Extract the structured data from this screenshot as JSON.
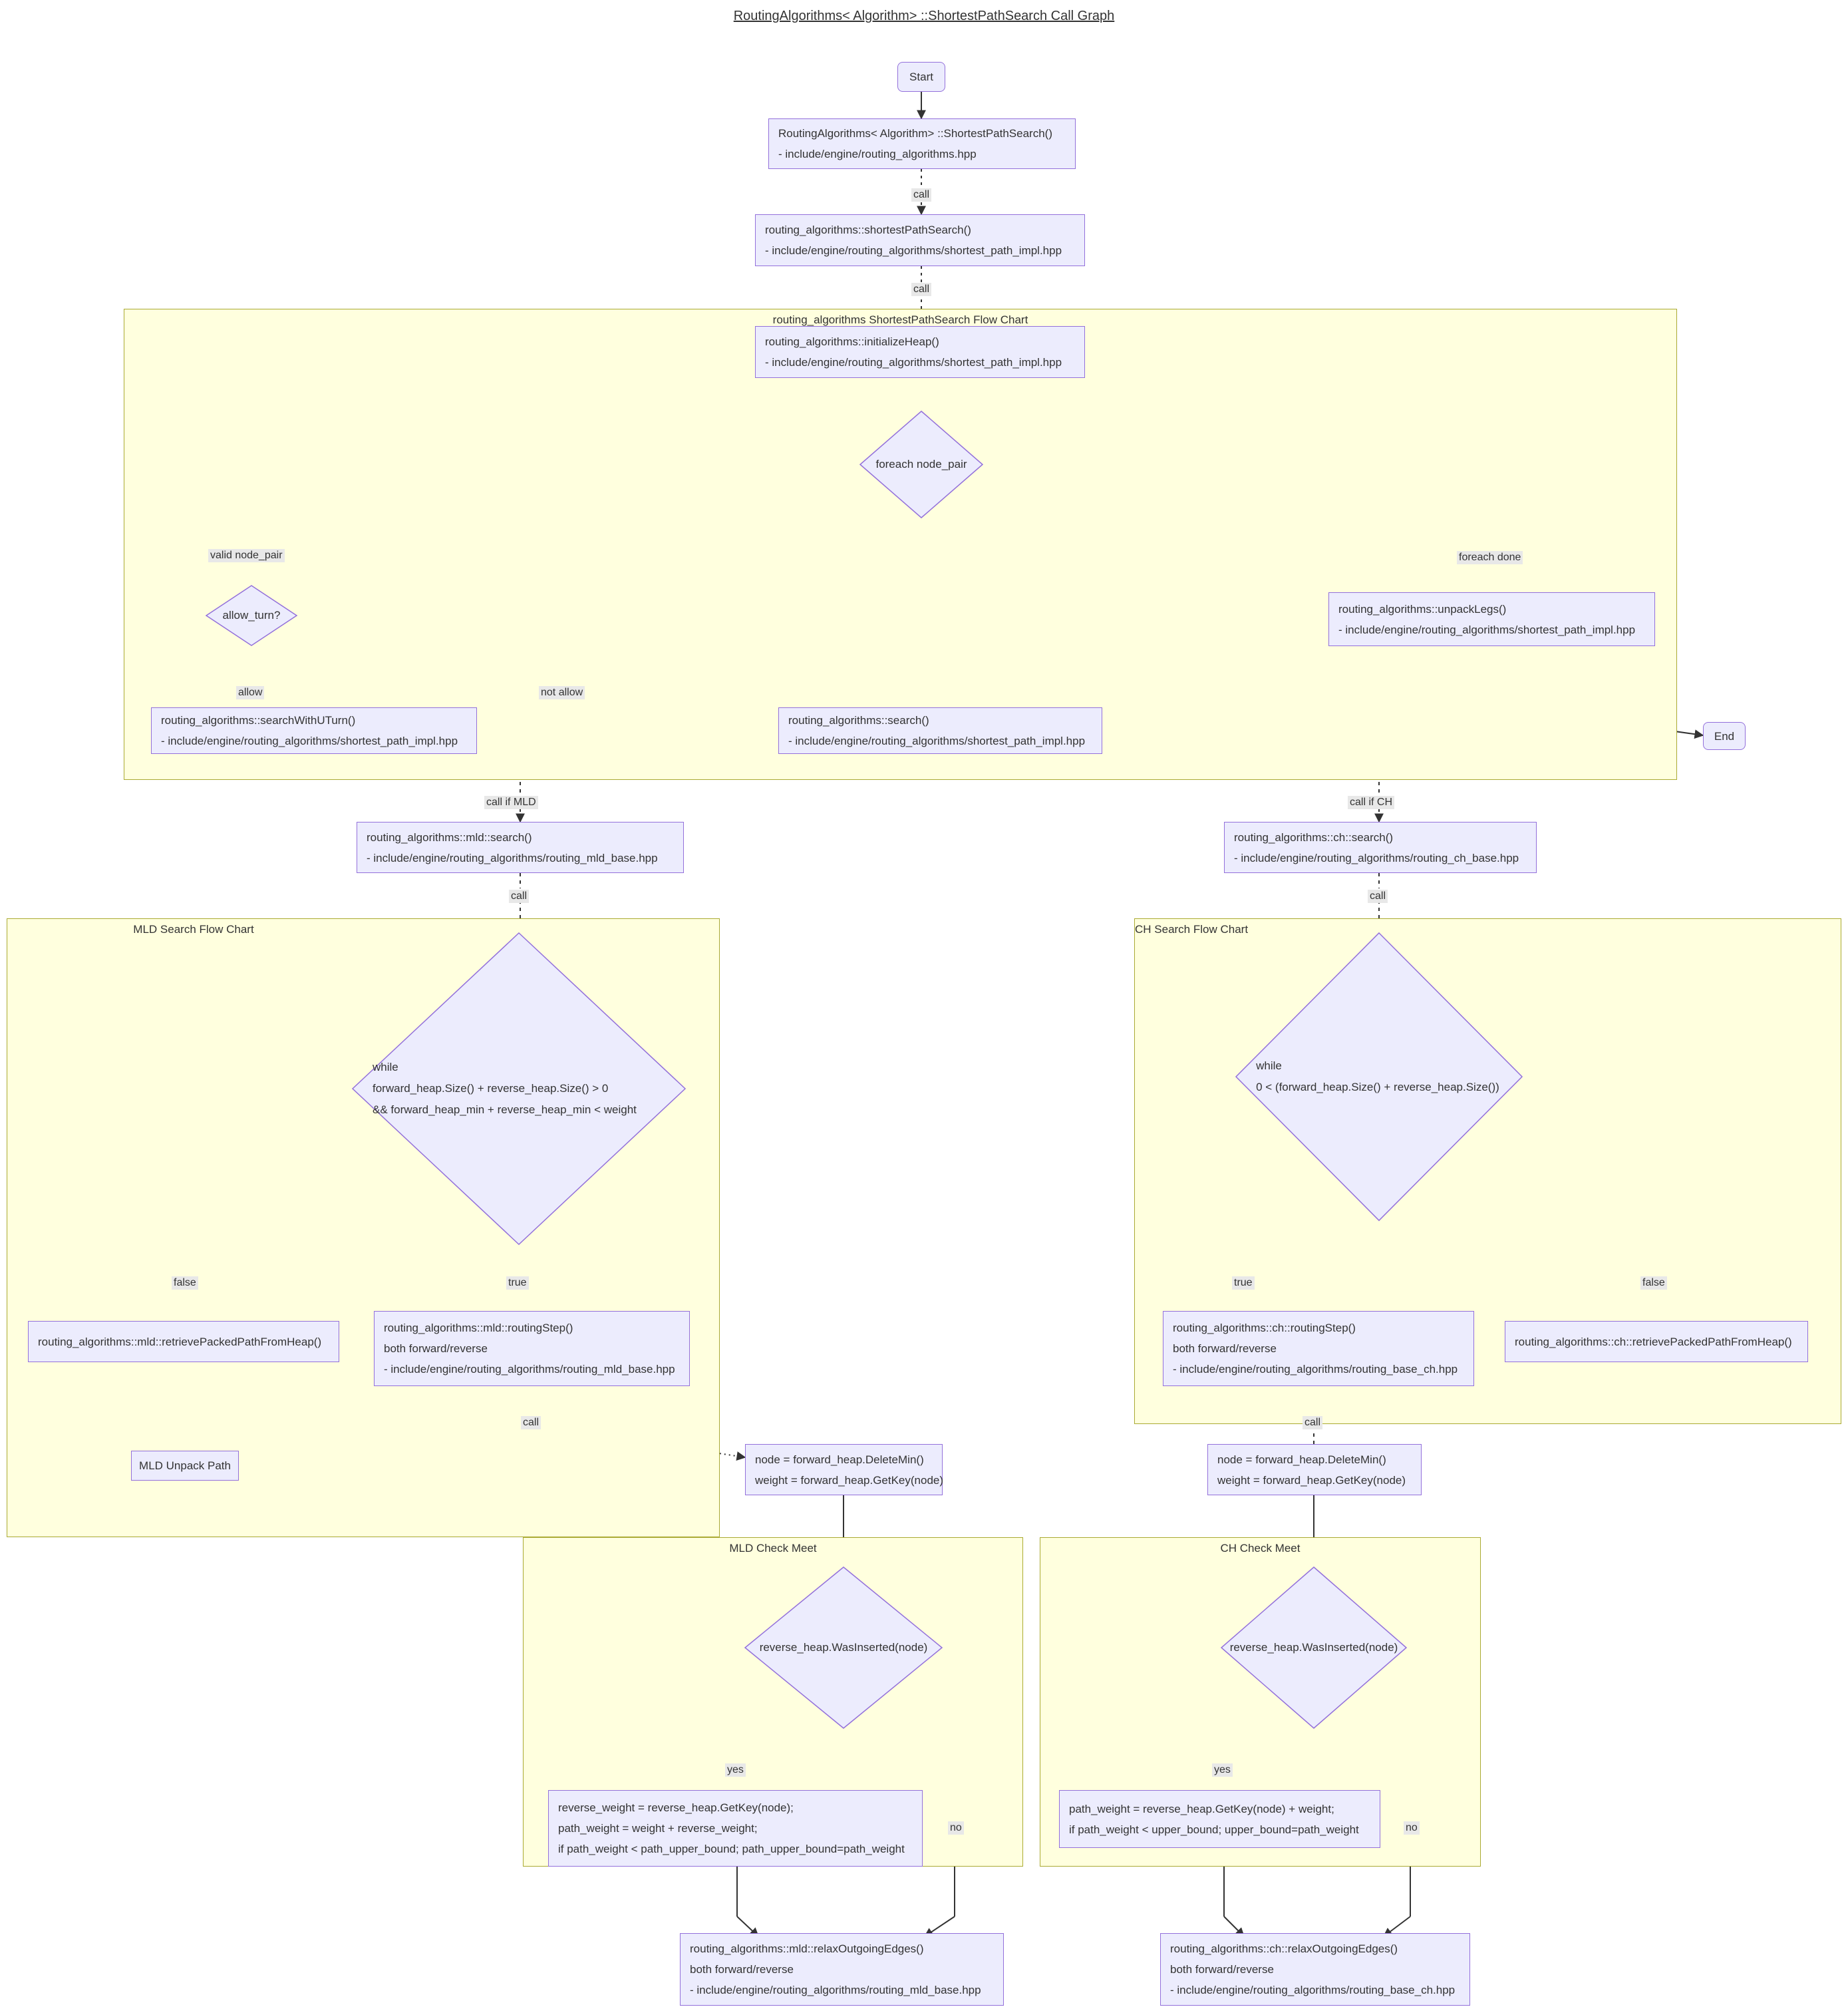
{
  "diagram": {
    "title": "RoutingAlgorithms< Algorithm> ::ShortestPathSearch Call Graph",
    "colors": {
      "node_fill": "#ececfd",
      "node_stroke": "#9370db",
      "cluster_fill": "#ffffde",
      "cluster_stroke": "#aaaa33",
      "edge": "#333333",
      "label_bg": "#e8e8e8"
    }
  },
  "clusters": {
    "main_flow": {
      "label": "routing_algorithms ShortestPathSearch Flow Chart"
    },
    "mld_search": {
      "label": "MLD Search Flow Chart"
    },
    "ch_search": {
      "label": "CH Search Flow Chart"
    },
    "mld_check_meet": {
      "label": "MLD Check Meet"
    },
    "ch_check_meet": {
      "label": "CH Check Meet"
    }
  },
  "nodes": {
    "start": {
      "label": "Start"
    },
    "end": {
      "label": "End"
    },
    "shortest_path_search": {
      "line1": "RoutingAlgorithms< Algorithm> ::ShortestPathSearch()",
      "line2": "- include/engine/routing_algorithms.hpp"
    },
    "ra_shortest_path_search": {
      "line1": "routing_algorithms::shortestPathSearch()",
      "line2": "- include/engine/routing_algorithms/shortest_path_impl.hpp"
    },
    "initialize_heap": {
      "line1": "routing_algorithms::initializeHeap()",
      "line2": "- include/engine/routing_algorithms/shortest_path_impl.hpp"
    },
    "foreach_node_pair": {
      "label": "foreach node_pair"
    },
    "allow_turn": {
      "label": "allow_turn?"
    },
    "search_with_uturn": {
      "line1": "routing_algorithms::searchWithUTurn()",
      "line2": "- include/engine/routing_algorithms/shortest_path_impl.hpp"
    },
    "search": {
      "line1": "routing_algorithms::search()",
      "line2": "- include/engine/routing_algorithms/shortest_path_impl.hpp"
    },
    "unpack_legs": {
      "line1": "routing_algorithms::unpackLegs()",
      "line2": "- include/engine/routing_algorithms/shortest_path_impl.hpp"
    },
    "mld_search": {
      "line1": "routing_algorithms::mld::search()",
      "line2": "- include/engine/routing_algorithms/routing_mld_base.hpp"
    },
    "ch_search": {
      "line1": "routing_algorithms::ch::search()",
      "line2": "- include/engine/routing_algorithms/routing_ch_base.hpp"
    },
    "mld_while": {
      "line1": "while",
      "line2": "forward_heap.Size() + reverse_heap.Size() > 0",
      "line3": "&& forward_heap_min + reverse_heap_min < weight"
    },
    "ch_while": {
      "line1": "while",
      "line2": "0 < (forward_heap.Size() + reverse_heap.Size())"
    },
    "mld_retrieve": {
      "label": "routing_algorithms::mld::retrievePackedPathFromHeap()"
    },
    "ch_retrieve": {
      "label": "routing_algorithms::ch::retrievePackedPathFromHeap()"
    },
    "mld_unpack_path": {
      "label": "MLD Unpack Path"
    },
    "mld_routing_step": {
      "line1": "routing_algorithms::mld::routingStep()",
      "line2": "both forward/reverse",
      "line3": "- include/engine/routing_algorithms/routing_mld_base.hpp"
    },
    "ch_routing_step": {
      "line1": "routing_algorithms::ch::routingStep()",
      "line2": "both forward/reverse",
      "line3": "- include/engine/routing_algorithms/routing_base_ch.hpp"
    },
    "mld_delete_min": {
      "line1": "node = forward_heap.DeleteMin()",
      "line2": "weight = forward_heap.GetKey(node)"
    },
    "ch_delete_min": {
      "line1": "node = forward_heap.DeleteMin()",
      "line2": "weight = forward_heap.GetKey(node)"
    },
    "mld_was_inserted": {
      "label": "reverse_heap.WasInserted(node)"
    },
    "ch_was_inserted": {
      "label": "reverse_heap.WasInserted(node)"
    },
    "mld_path_weight": {
      "line1": "reverse_weight = reverse_heap.GetKey(node);",
      "line2": "path_weight = weight + reverse_weight;",
      "line3": "if path_weight < path_upper_bound; path_upper_bound=path_weight"
    },
    "ch_path_weight": {
      "line1": "path_weight = reverse_heap.GetKey(node) + weight;",
      "line2": "if path_weight < upper_bound; upper_bound=path_weight"
    },
    "mld_relax": {
      "line1": "routing_algorithms::mld::relaxOutgoingEdges()",
      "line2": "both forward/reverse",
      "line3": "- include/engine/routing_algorithms/routing_mld_base.hpp"
    },
    "ch_relax": {
      "line1": "routing_algorithms::ch::relaxOutgoingEdges()",
      "line2": "both forward/reverse",
      "line3": "- include/engine/routing_algorithms/routing_base_ch.hpp"
    }
  },
  "edge_labels": {
    "call_1": "call",
    "call_2": "call",
    "valid_node_pair": "valid node_pair",
    "allow": "allow",
    "not_allow": "not allow",
    "foreach_done": "foreach done",
    "call_if_mld": "call if MLD",
    "call_if_ch": "call if CH",
    "call_mld": "call",
    "call_ch": "call",
    "mld_false": "false",
    "mld_true": "true",
    "ch_true": "true",
    "ch_false": "false",
    "mld_step_call": "call",
    "ch_step_call": "call",
    "mld_yes": "yes",
    "mld_no": "no",
    "ch_yes": "yes",
    "ch_no": "no"
  }
}
